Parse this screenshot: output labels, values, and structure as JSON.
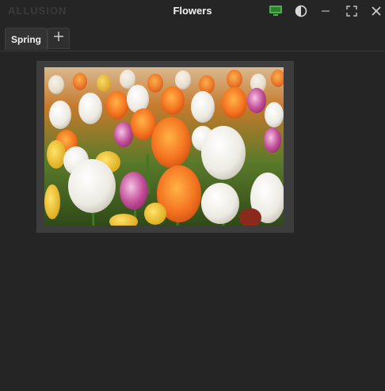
{
  "titlebar": {
    "app_name": "ALLUSION",
    "title": "Flowers",
    "buttons": [
      {
        "name": "monitor-icon",
        "color": "#4caf50"
      },
      {
        "name": "contrast-icon"
      },
      {
        "name": "minimize-icon"
      },
      {
        "name": "fullscreen-icon"
      },
      {
        "name": "close-icon"
      }
    ]
  },
  "tabs": [
    {
      "label": "Spring",
      "active": true
    }
  ],
  "add_tab_icon": "plus-icon",
  "gallery": {
    "items": [
      {
        "subject": "tulips"
      }
    ]
  },
  "colors": {
    "background": "#252525",
    "accent_green": "#4caf50",
    "frame": "#3d3d3d"
  }
}
